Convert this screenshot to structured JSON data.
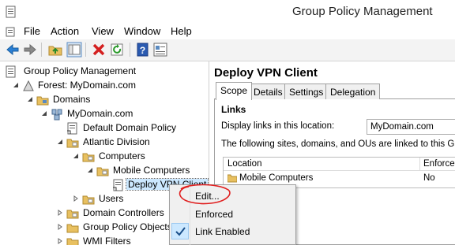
{
  "window": {
    "title": "Group Policy Management"
  },
  "menu": [
    "File",
    "Action",
    "View",
    "Window",
    "Help"
  ],
  "toolbar": {
    "buttons": [
      "back-arrow-icon",
      "forward-arrow-icon",
      "folder-up-icon",
      "show-hide-tree-icon",
      "delete-icon",
      "refresh-icon",
      "help-icon",
      "properties-icon"
    ]
  },
  "tree": {
    "root": "Group Policy Management",
    "forest": "Forest: MyDomain.com",
    "domains": "Domains",
    "domain": "MyDomain.com",
    "default_policy": "Default Domain Policy",
    "atlantic": "Atlantic Division",
    "computers": "Computers",
    "mobile": "Mobile Computers",
    "deploy": "Deploy VPN Client",
    "users": "Users",
    "dc": "Domain Controllers",
    "gpo": "Group Policy Objects",
    "wmi": "WMI Filters"
  },
  "details": {
    "title": "Deploy VPN Client",
    "tabs": [
      "Scope",
      "Details",
      "Settings",
      "Delegation"
    ],
    "active_tab": "Scope",
    "links_heading": "Links",
    "display_links_label": "Display links in this location:",
    "display_links_value": "MyDomain.com",
    "linked_text": "The following sites, domains, and OUs are linked to this GPO:",
    "columns": [
      "Location",
      "Enforced"
    ],
    "rows": [
      {
        "location": "Mobile Computers",
        "enforced": "No"
      }
    ]
  },
  "context_menu": {
    "items": [
      {
        "label": "Edit...",
        "checked": false
      },
      {
        "label": "Enforced",
        "checked": false
      },
      {
        "label": "Link Enabled",
        "checked": true
      }
    ]
  },
  "colors": {
    "selection": "#cce8ff",
    "annotation_circle": "#e02020",
    "folder": "#e8c060"
  }
}
